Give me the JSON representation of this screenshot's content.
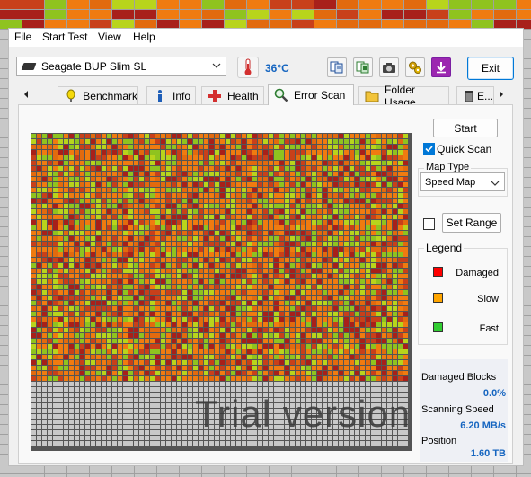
{
  "menu": [
    "File",
    "Start Test",
    "View",
    "Help"
  ],
  "drive": {
    "name": "Seagate BUP Slim SL"
  },
  "temperature": "36°C",
  "toolbar": {
    "exit_label": "Exit"
  },
  "tabs": [
    {
      "label": "Benchmark",
      "icon": "stopwatch-icon"
    },
    {
      "label": "Info",
      "icon": "info-icon"
    },
    {
      "label": "Health",
      "icon": "health-cross-icon"
    },
    {
      "label": "Error Scan",
      "icon": "magnifier-icon",
      "active": true
    },
    {
      "label": "Folder Usage",
      "icon": "folder-icon"
    },
    {
      "label": "E...",
      "icon": "trash-icon"
    }
  ],
  "scan": {
    "start_label": "Start",
    "quick_scan_label": "Quick Scan",
    "quick_scan_checked": true,
    "map_type_title": "Map Type",
    "map_type_value": "Speed Map",
    "set_range_checked": false,
    "set_range_label": "Set Range",
    "legend_title": "Legend",
    "legend": [
      {
        "label": "Damaged",
        "color": "#ff0000"
      },
      {
        "label": "Slow",
        "color": "#ffa500"
      },
      {
        "label": "Fast",
        "color": "#32cd32"
      }
    ],
    "watermark": "Trial version",
    "stats": {
      "damaged_blocks_label": "Damaged Blocks",
      "damaged_blocks_value": "0.0%",
      "scanning_speed_label": "Scanning Speed",
      "scanning_speed_value": "6.20 MB/s",
      "position_label": "Position",
      "position_value": "1.60 TB"
    },
    "map_colors": {
      "dark_red": "#a8201a",
      "red": "#c8401a",
      "orange": "#f07b10",
      "orange_dark": "#e26a0e",
      "yellow_green": "#b8d41c",
      "green": "#8fc31f",
      "unscanned": "#c8c8c8"
    },
    "scanned_fraction": 0.79
  }
}
